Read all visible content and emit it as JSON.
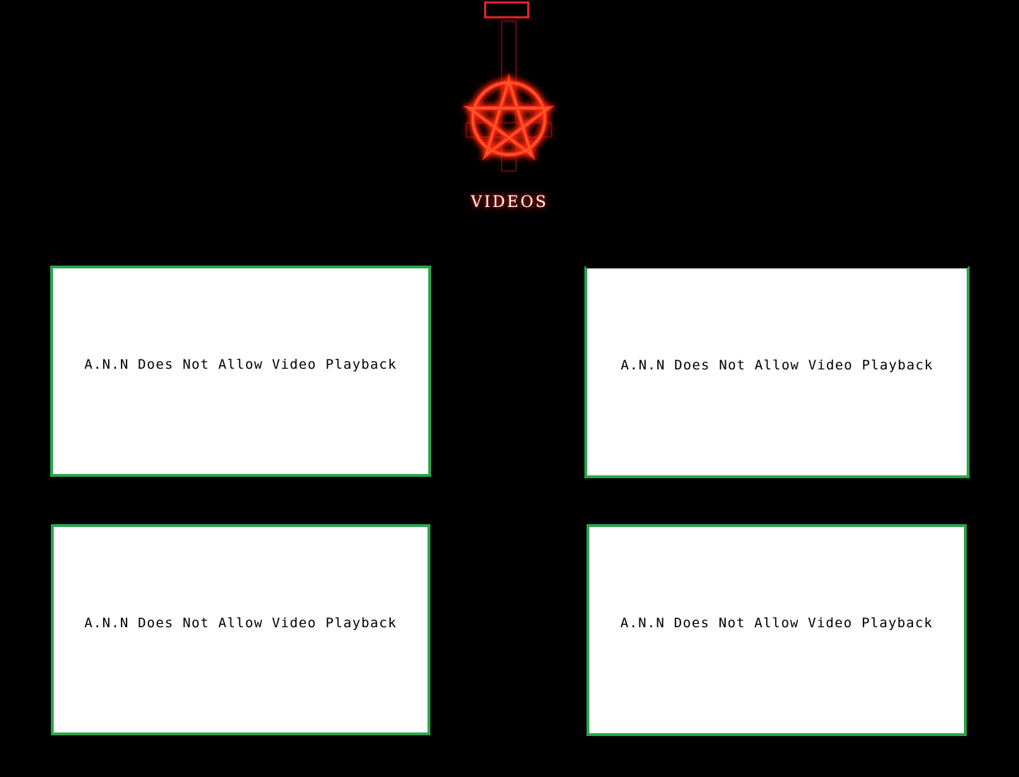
{
  "header": {
    "title": "VIDEOS",
    "emblem_icon": "inverted-cross-pentagram-icon",
    "tab_icon": "tab-outline-icon",
    "accent_color": "#e0242a",
    "glow_color": "#ff2a1a"
  },
  "videos": [
    {
      "message": "A.N.N Does Not Allow Video Playback"
    },
    {
      "message": "A.N.N Does Not Allow Video Playback"
    },
    {
      "message": "A.N.N Does Not Allow Video Playback"
    },
    {
      "message": "A.N.N Does Not Allow Video Playback"
    }
  ],
  "colors": {
    "background": "#000000",
    "panel_border": "#2aa64a",
    "panel_fill": "#ffffff",
    "panel_text": "#000000"
  }
}
